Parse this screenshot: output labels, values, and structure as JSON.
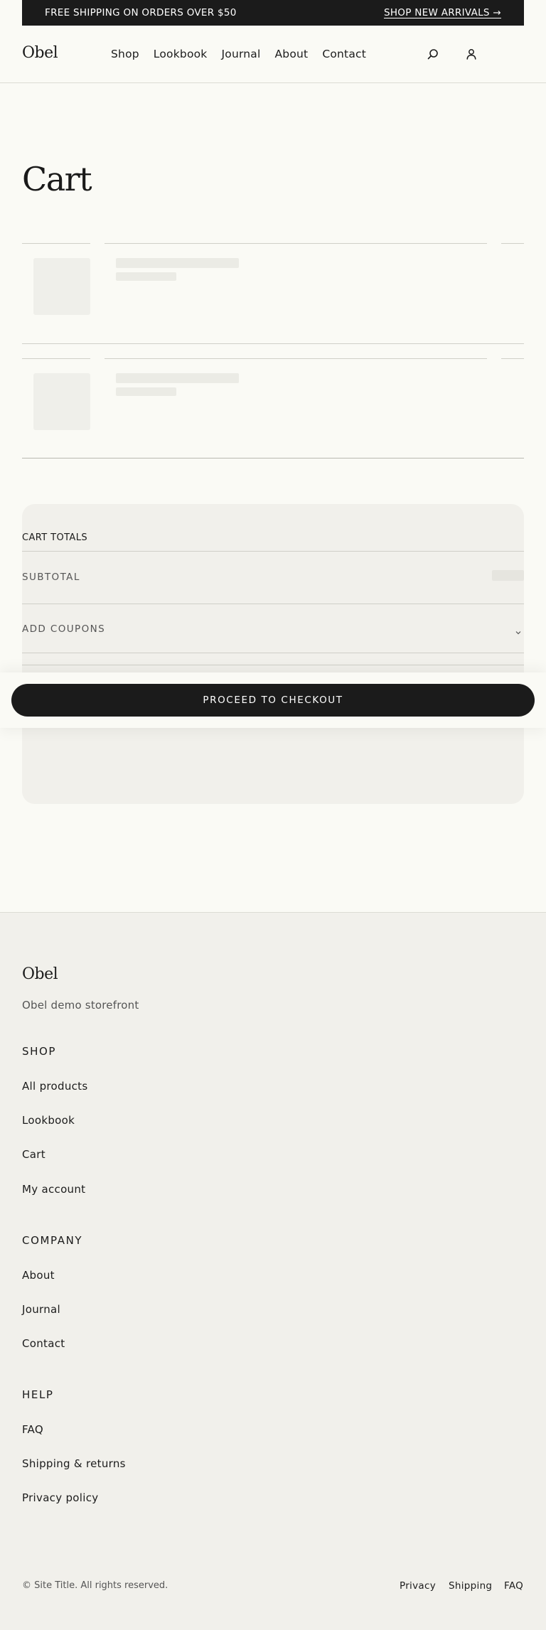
{
  "announcement": {
    "text": "FREE SHIPPING ON ORDERS OVER $50",
    "link": "SHOP NEW ARRIVALS →"
  },
  "header": {
    "logo": "Obel",
    "nav": [
      "Shop",
      "Lookbook",
      "Journal",
      "About",
      "Contact"
    ]
  },
  "page": {
    "title": "Cart"
  },
  "totals": {
    "title": "CART TOTALS",
    "subtotal_label": "SUBTOTAL",
    "coupons_label": "ADD COUPONS",
    "checkout_label": "PROCEED TO CHECKOUT"
  },
  "footer": {
    "logo": "Obel",
    "tagline": "Obel demo storefront",
    "sections": [
      {
        "heading": "SHOP",
        "links": [
          "All products",
          "Lookbook",
          "Cart",
          "My account"
        ]
      },
      {
        "heading": "COMPANY",
        "links": [
          "About",
          "Journal",
          "Contact"
        ]
      },
      {
        "heading": "HELP",
        "links": [
          "FAQ",
          "Shipping & returns",
          "Privacy policy"
        ]
      }
    ],
    "copyright": "© Site Title. All rights reserved.",
    "legal": [
      "Privacy",
      "Shipping",
      "FAQ"
    ]
  }
}
